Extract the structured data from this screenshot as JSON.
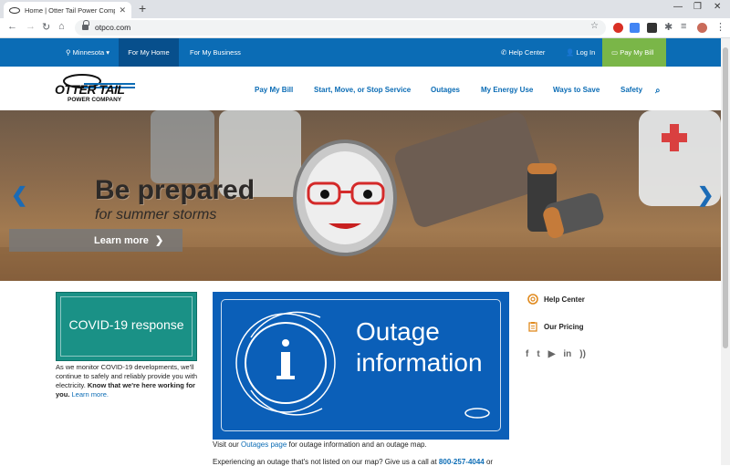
{
  "browser": {
    "tab_title": "Home | Otter Tail Power Company",
    "url": "otpco.com"
  },
  "topbar": {
    "state": "Minnesota",
    "for_home": "For My Home",
    "for_business": "For My Business",
    "help_center": "Help Center",
    "log_in": "Log In",
    "pay_bill": "Pay My Bill"
  },
  "logo": {
    "line1": "OTTER TAIL",
    "line2": "POWER COMPANY"
  },
  "main_nav": {
    "items": [
      "Pay My Bill",
      "Start, Move, or Stop Service",
      "Outages",
      "My Energy Use",
      "Ways to Save",
      "Safety"
    ]
  },
  "hero": {
    "headline": "Be prepared",
    "subline": "for summer storms",
    "cta": "Learn more"
  },
  "covid": {
    "title": "COVID-19 response",
    "text": "As we monitor COVID-19 developments, we'll continue to safely and reliably provide you with electricity.",
    "bold": "Know that we're here working for you.",
    "link": "Learn more."
  },
  "outage": {
    "line1": "Outage",
    "line2": "information",
    "visit_pre": "Visit our",
    "visit_link": "Outages page",
    "visit_post": "for outage information and an outage map.",
    "exp_text": "Experiencing an outage that's not listed on our map? Give us a call at",
    "exp_phone": "800-257-4044",
    "exp_post": "or"
  },
  "sidebar": {
    "help_center": "Help Center",
    "our_pricing": "Our Pricing"
  },
  "colors": {
    "brand_blue": "#0b6cb5",
    "pay_green": "#7ab648",
    "covid_teal": "#1a9186",
    "outage_blue": "#0b5fb8"
  }
}
